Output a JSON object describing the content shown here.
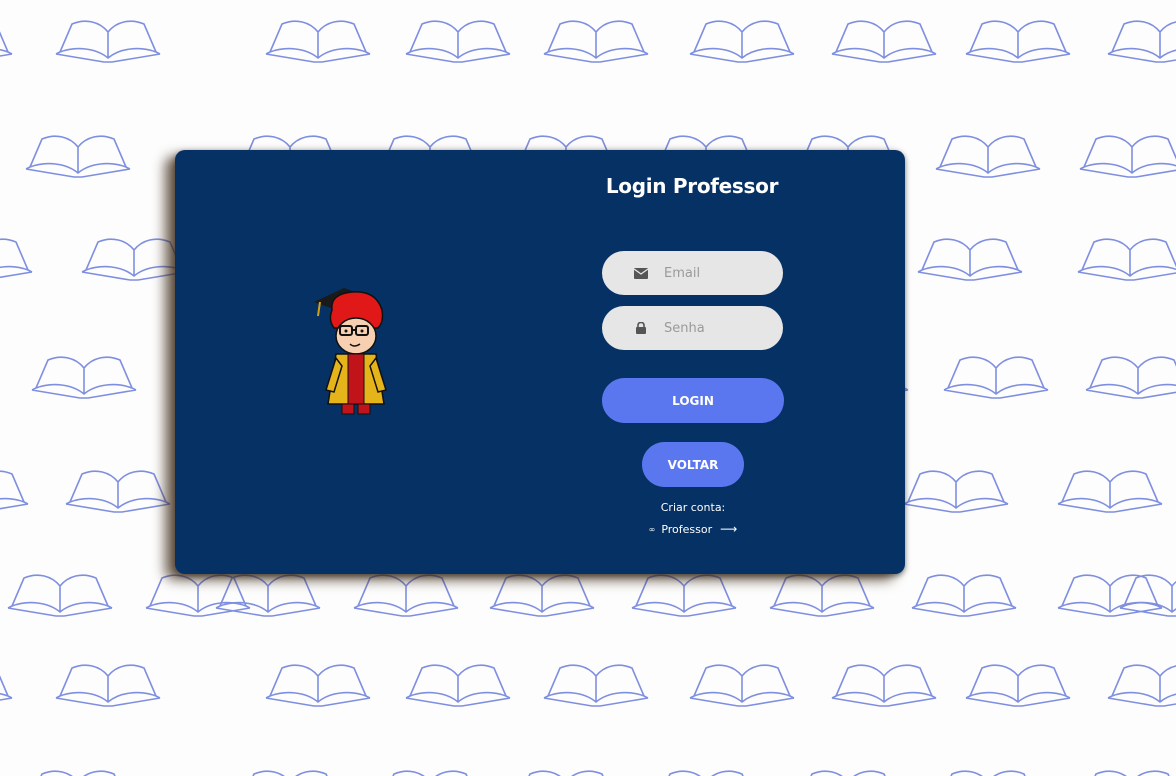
{
  "page": {
    "title": "Login Professor"
  },
  "form": {
    "email_placeholder": "Email",
    "password_placeholder": "Senha",
    "login_label": "LOGIN",
    "back_label": "VOLTAR"
  },
  "create_account": {
    "label": "Criar conta:",
    "link_label": "Professor"
  },
  "icons": {
    "email": "envelope-icon",
    "password": "lock-icon",
    "link_prefix": "infinity-icon",
    "link_suffix": "arrow-right-icon",
    "background": "open-book-icon",
    "mascot": "graduate-mascot"
  },
  "colors": {
    "card": "#063165",
    "button": "#5b77f0",
    "field": "#e6e6e6",
    "pattern": "#7f8fe0"
  }
}
